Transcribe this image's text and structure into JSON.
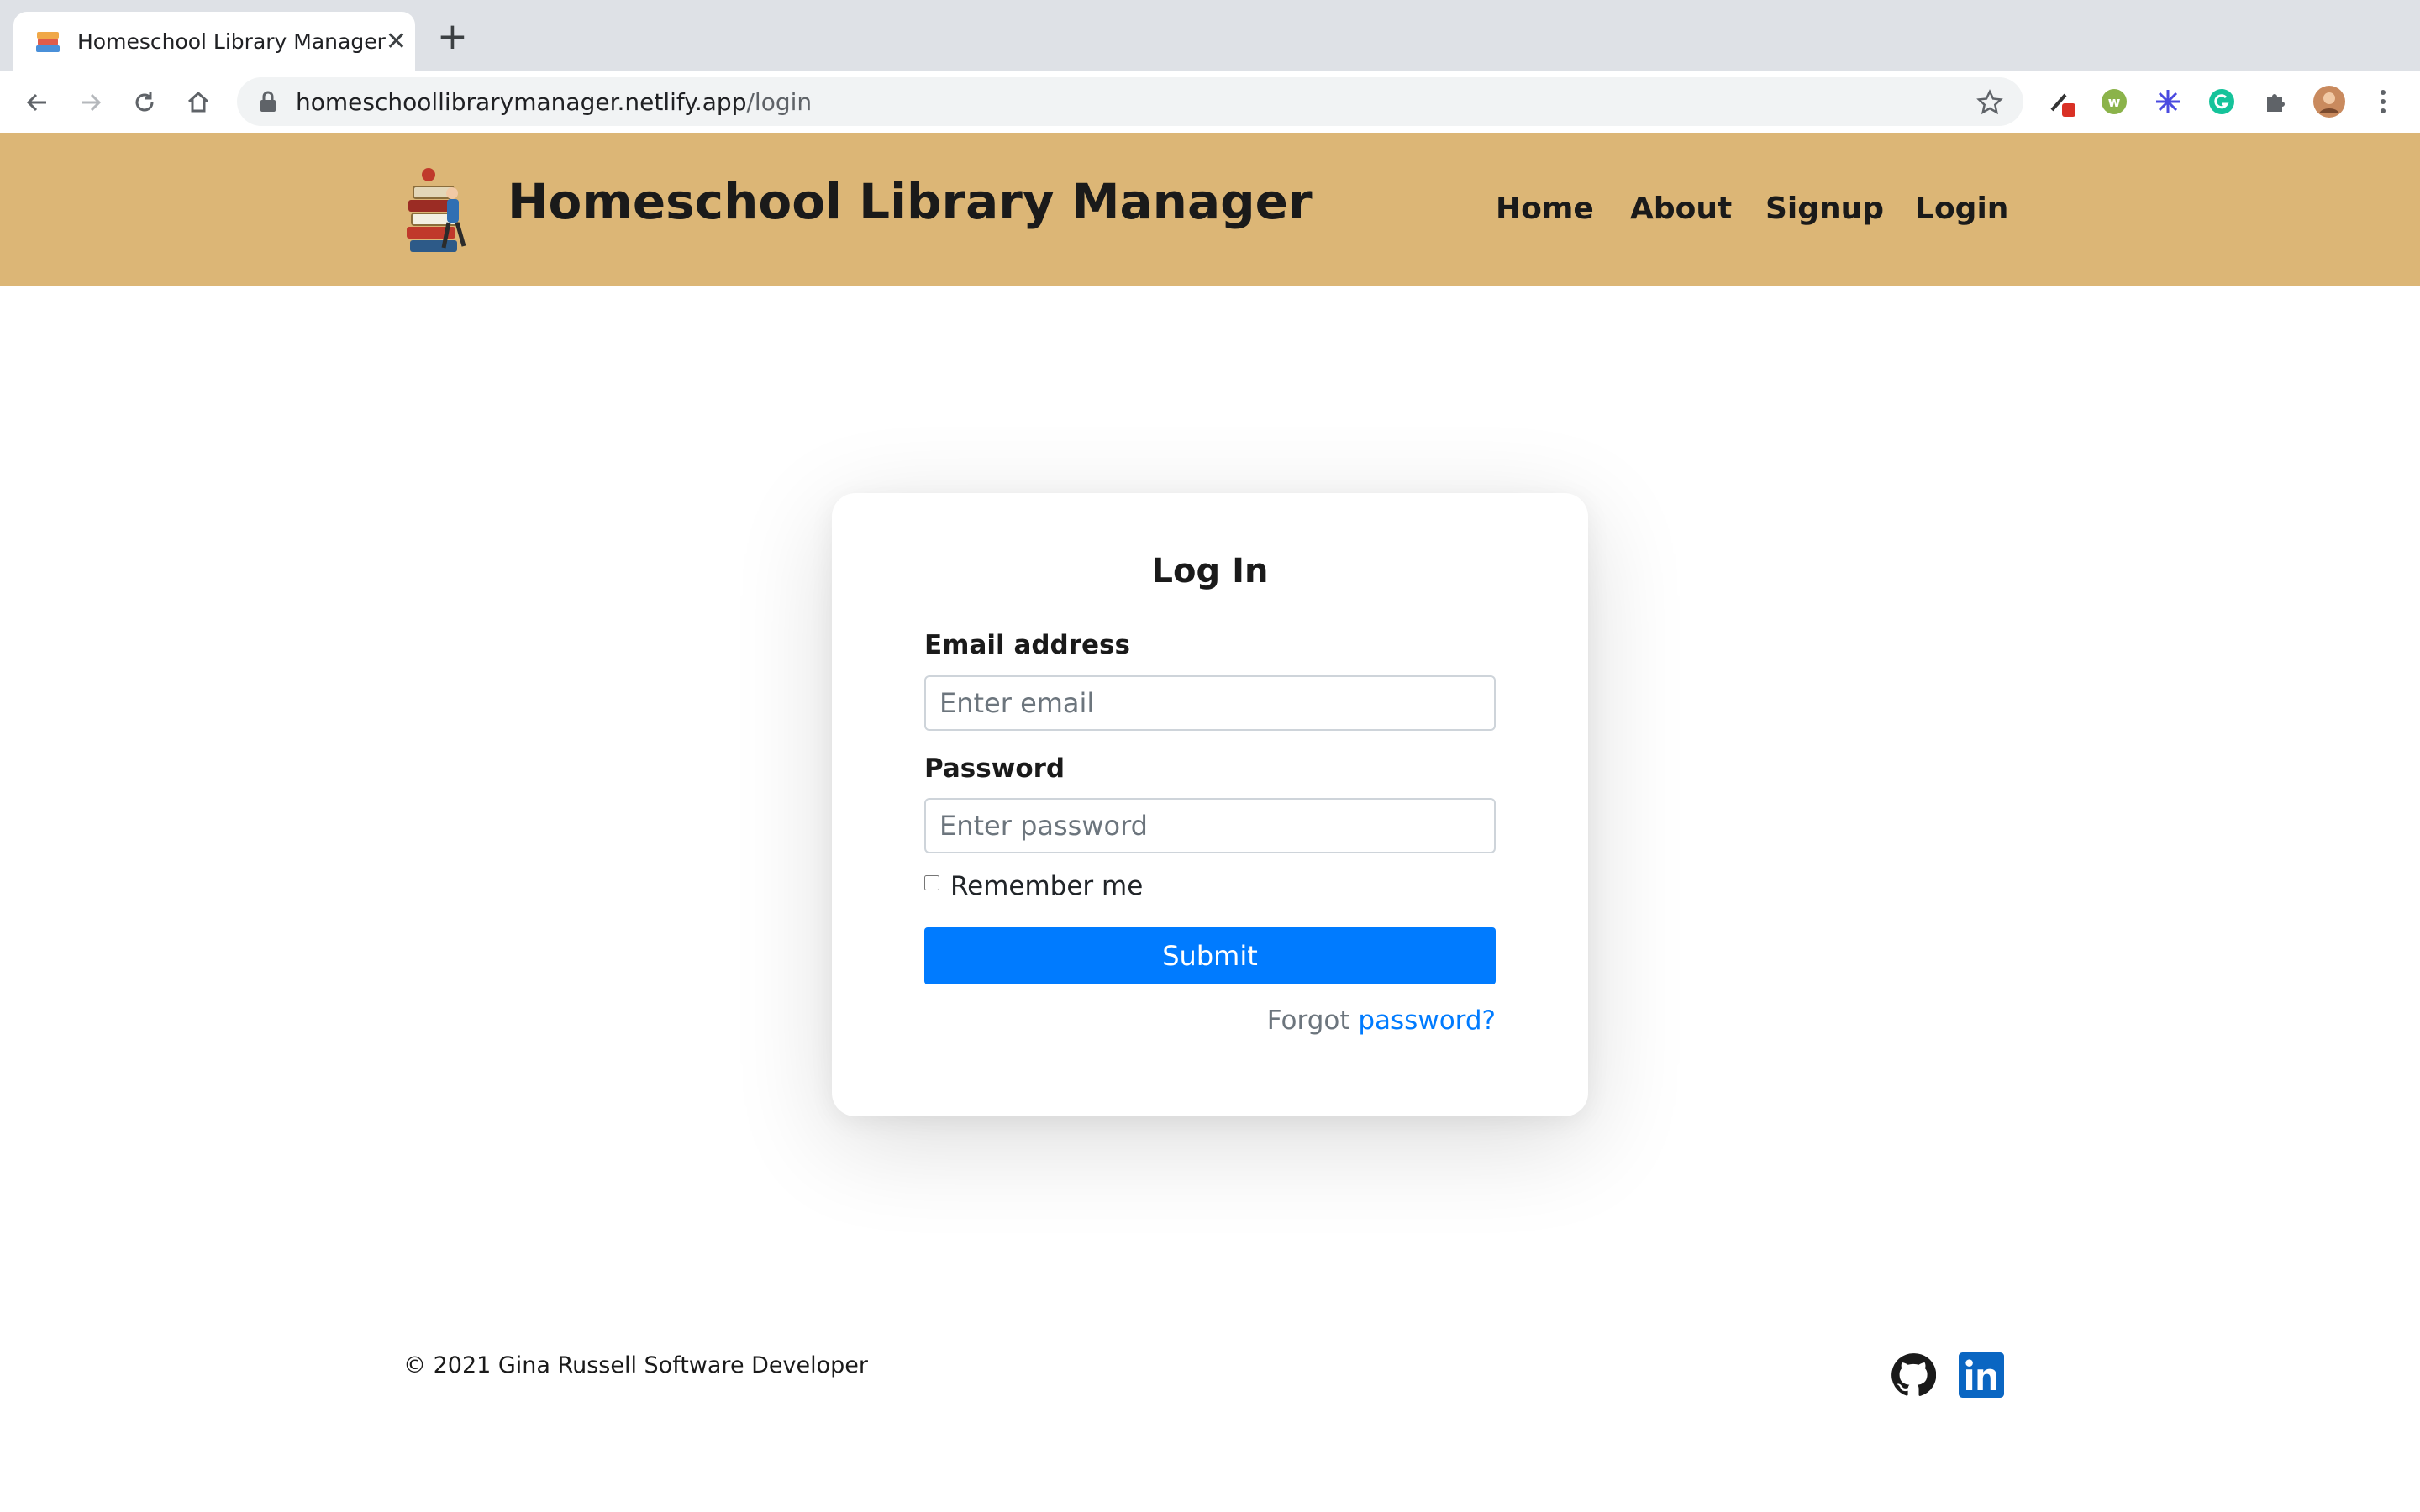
{
  "browser": {
    "tab_title": "Homeschool Library Manager",
    "url_host": "homeschoollibrarymanager.netlify.app",
    "url_path": "/login",
    "new_tab_glyph": "+",
    "close_glyph": "✕"
  },
  "header": {
    "title": "Homeschool Library Manager",
    "background": "#dcb676",
    "nav": [
      "Home",
      "About",
      "Signup",
      "Login"
    ]
  },
  "form": {
    "title": "Log In",
    "email_label": "Email address",
    "email_placeholder": "Enter email",
    "password_label": "Password",
    "password_placeholder": "Enter password",
    "remember_label": "Remember me",
    "submit_label": "Submit",
    "forgot_prefix": "Forgot",
    "forgot_link": "password?",
    "accent": "#007bff"
  },
  "footer": {
    "copyright": "© 2021 Gina Russell Software Developer",
    "icons": [
      "github-icon",
      "linkedin-icon"
    ]
  }
}
